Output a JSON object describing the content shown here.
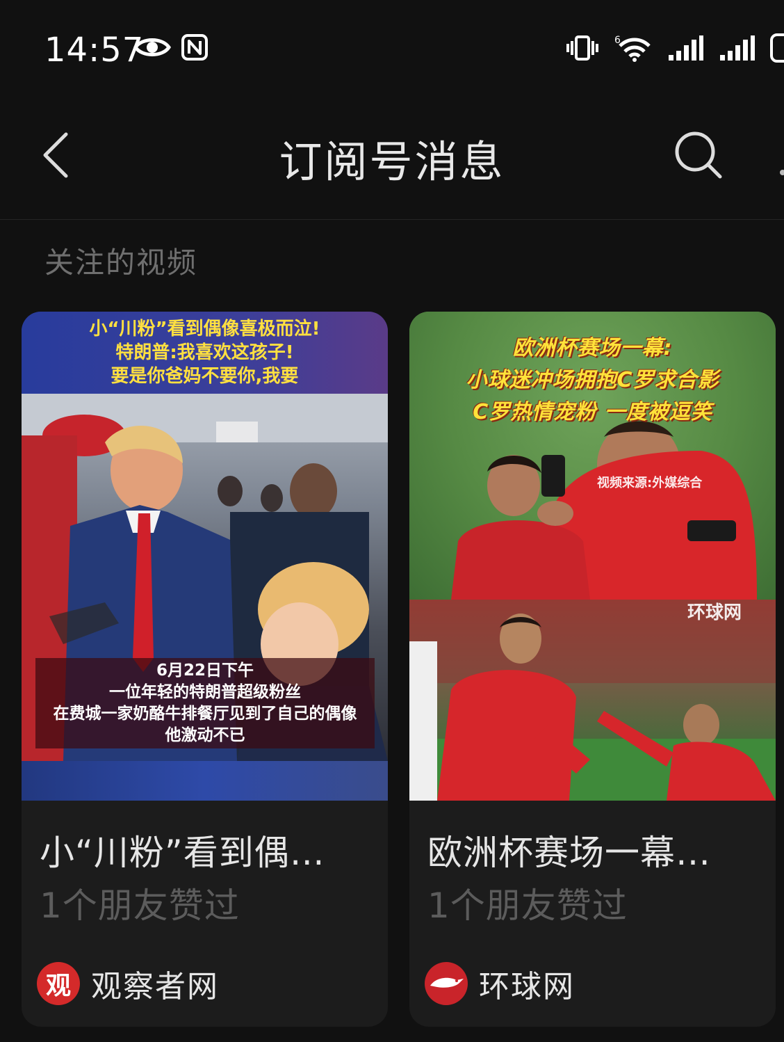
{
  "status_bar": {
    "time": "14:57"
  },
  "nav": {
    "title": "订阅号消息"
  },
  "section": {
    "title": "关注的视频"
  },
  "cards": [
    {
      "thumbnail": {
        "banner_lines": [
          "小“川粉”看到偶像喜极而泣!",
          "特朗普:我喜欢这孩子!",
          "要是你爸妈不要你,我要"
        ],
        "caption_lines": [
          "6月22日下午",
          "一位年轻的特朗普超级粉丝",
          "在费城一家奶酪牛排餐厅见到了自己的偶像",
          "他激动不已"
        ]
      },
      "title": "小“川粉”看到偶…",
      "likes": "1个朋友赞过",
      "source": {
        "name": "观察者网",
        "avatar_char": "观"
      }
    },
    {
      "thumbnail": {
        "banner_lines": [
          "欧洲杯赛场一幕:",
          "小球迷冲场拥抱C罗求合影",
          "C罗热情宠粉 一度被逗笑"
        ],
        "source_note": "视频来源:外媒综合",
        "watermark": "环球网"
      },
      "title": "欧洲杯赛场一幕…",
      "likes": "1个朋友赞过",
      "source": {
        "name": "环球网"
      }
    }
  ],
  "icons": {
    "eye": "eye-icon",
    "nfc": "nfc-icon",
    "vibrate": "vibrate-icon",
    "wifi": "wifi-icon",
    "signal": "signal-icon",
    "battery": "battery-icon",
    "back": "back-chevron-icon",
    "search": "search-icon"
  },
  "colors": {
    "background": "#111111",
    "card": "#1c1c1c",
    "section_title": "#6f6f6f",
    "likes_text": "#5c5c5c",
    "source_avatar": "#d42a2a"
  }
}
